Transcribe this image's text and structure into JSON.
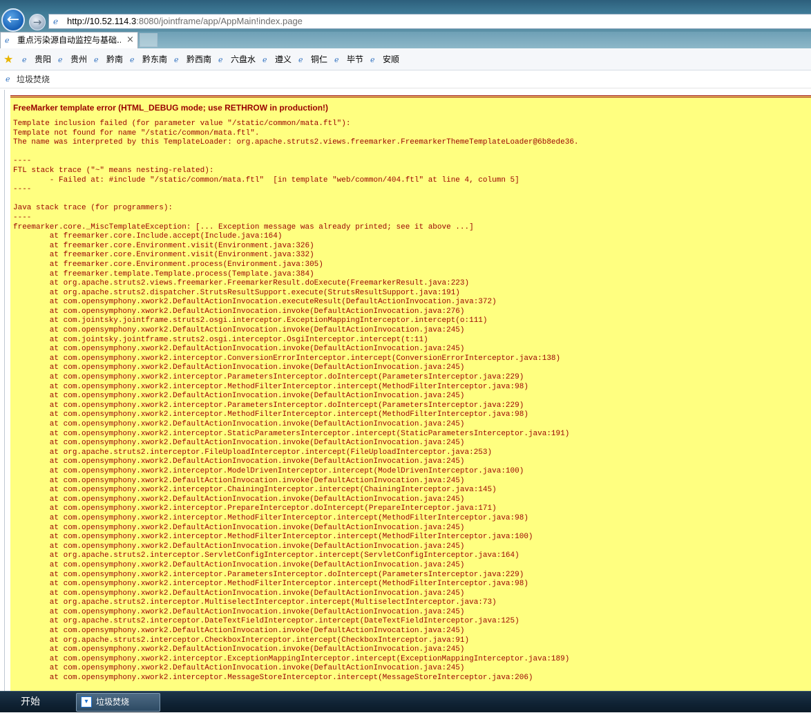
{
  "browser": {
    "back_icon": "←",
    "forward_icon": "→",
    "address_host": "http://10.52.114.3",
    "address_path": ":8080/jointframe/app/AppMain!index.page",
    "tab_title": "重点污染源自动监控与基础...",
    "tab_close": "×"
  },
  "favorites": {
    "items": [
      {
        "label": "贵阳"
      },
      {
        "label": "贵州"
      },
      {
        "label": "黔南"
      },
      {
        "label": "黔东南"
      },
      {
        "label": "黔西南"
      },
      {
        "label": "六盘水"
      },
      {
        "label": "遵义"
      },
      {
        "label": "铜仁"
      },
      {
        "label": "毕节"
      },
      {
        "label": "安顺"
      }
    ]
  },
  "page": {
    "header_title": "垃圾焚烧"
  },
  "error": {
    "title": "FreeMarker template error (HTML_DEBUG mode; use RETHROW in production!)",
    "message_lines": [
      "Template inclusion failed (for parameter value \"/static/common/mata.ftl\"):",
      "Template not found for name \"/static/common/mata.ftl\".",
      "The name was interpreted by this TemplateLoader: org.apache.struts2.views.freemarker.FreemarkerThemeTemplateLoader@6b8ede36.",
      "",
      "----",
      "FTL stack trace (\"~\" means nesting-related):",
      "        - Failed at: #include \"/static/common/mata.ftl\"  [in template \"web/common/404.ftl\" at line 4, column 5]",
      "----",
      "",
      "Java stack trace (for programmers):",
      "----",
      "freemarker.core._MiscTemplateException: [... Exception message was already printed; see it above ...]",
      "        at freemarker.core.Include.accept(Include.java:164)",
      "        at freemarker.core.Environment.visit(Environment.java:326)",
      "        at freemarker.core.Environment.visit(Environment.java:332)",
      "        at freemarker.core.Environment.process(Environment.java:305)",
      "        at freemarker.template.Template.process(Template.java:384)",
      "        at org.apache.struts2.views.freemarker.FreemarkerResult.doExecute(FreemarkerResult.java:223)",
      "        at org.apache.struts2.dispatcher.StrutsResultSupport.execute(StrutsResultSupport.java:191)",
      "        at com.opensymphony.xwork2.DefaultActionInvocation.executeResult(DefaultActionInvocation.java:372)",
      "        at com.opensymphony.xwork2.DefaultActionInvocation.invoke(DefaultActionInvocation.java:276)",
      "        at com.jointsky.jointframe.struts2.osgi.interceptor.ExceptionMappingInterceptor.intercept(o:111)",
      "        at com.opensymphony.xwork2.DefaultActionInvocation.invoke(DefaultActionInvocation.java:245)",
      "        at com.jointsky.jointframe.struts2.osgi.interceptor.OsgiInterceptor.intercept(t:11)",
      "        at com.opensymphony.xwork2.DefaultActionInvocation.invoke(DefaultActionInvocation.java:245)",
      "        at com.opensymphony.xwork2.interceptor.ConversionErrorInterceptor.intercept(ConversionErrorInterceptor.java:138)",
      "        at com.opensymphony.xwork2.DefaultActionInvocation.invoke(DefaultActionInvocation.java:245)",
      "        at com.opensymphony.xwork2.interceptor.ParametersInterceptor.doIntercept(ParametersInterceptor.java:229)",
      "        at com.opensymphony.xwork2.interceptor.MethodFilterInterceptor.intercept(MethodFilterInterceptor.java:98)",
      "        at com.opensymphony.xwork2.DefaultActionInvocation.invoke(DefaultActionInvocation.java:245)",
      "        at com.opensymphony.xwork2.interceptor.ParametersInterceptor.doIntercept(ParametersInterceptor.java:229)",
      "        at com.opensymphony.xwork2.interceptor.MethodFilterInterceptor.intercept(MethodFilterInterceptor.java:98)",
      "        at com.opensymphony.xwork2.DefaultActionInvocation.invoke(DefaultActionInvocation.java:245)",
      "        at com.opensymphony.xwork2.interceptor.StaticParametersInterceptor.intercept(StaticParametersInterceptor.java:191)",
      "        at com.opensymphony.xwork2.DefaultActionInvocation.invoke(DefaultActionInvocation.java:245)",
      "        at org.apache.struts2.interceptor.FileUploadInterceptor.intercept(FileUploadInterceptor.java:253)",
      "        at com.opensymphony.xwork2.DefaultActionInvocation.invoke(DefaultActionInvocation.java:245)",
      "        at com.opensymphony.xwork2.interceptor.ModelDrivenInterceptor.intercept(ModelDrivenInterceptor.java:100)",
      "        at com.opensymphony.xwork2.DefaultActionInvocation.invoke(DefaultActionInvocation.java:245)",
      "        at com.opensymphony.xwork2.interceptor.ChainingInterceptor.intercept(ChainingInterceptor.java:145)",
      "        at com.opensymphony.xwork2.DefaultActionInvocation.invoke(DefaultActionInvocation.java:245)",
      "        at com.opensymphony.xwork2.interceptor.PrepareInterceptor.doIntercept(PrepareInterceptor.java:171)",
      "        at com.opensymphony.xwork2.interceptor.MethodFilterInterceptor.intercept(MethodFilterInterceptor.java:98)",
      "        at com.opensymphony.xwork2.DefaultActionInvocation.invoke(DefaultActionInvocation.java:245)",
      "        at com.opensymphony.xwork2.interceptor.MethodFilterInterceptor.intercept(MethodFilterInterceptor.java:100)",
      "        at com.opensymphony.xwork2.DefaultActionInvocation.invoke(DefaultActionInvocation.java:245)",
      "        at org.apache.struts2.interceptor.ServletConfigInterceptor.intercept(ServletConfigInterceptor.java:164)",
      "        at com.opensymphony.xwork2.DefaultActionInvocation.invoke(DefaultActionInvocation.java:245)",
      "        at com.opensymphony.xwork2.interceptor.ParametersInterceptor.doIntercept(ParametersInterceptor.java:229)",
      "        at com.opensymphony.xwork2.interceptor.MethodFilterInterceptor.intercept(MethodFilterInterceptor.java:98)",
      "        at com.opensymphony.xwork2.DefaultActionInvocation.invoke(DefaultActionInvocation.java:245)",
      "        at org.apache.struts2.interceptor.MultiselectInterceptor.intercept(MultiselectInterceptor.java:73)",
      "        at com.opensymphony.xwork2.DefaultActionInvocation.invoke(DefaultActionInvocation.java:245)",
      "        at org.apache.struts2.interceptor.DateTextFieldInterceptor.intercept(DateTextFieldInterceptor.java:125)",
      "        at com.opensymphony.xwork2.DefaultActionInvocation.invoke(DefaultActionInvocation.java:245)",
      "        at org.apache.struts2.interceptor.CheckboxInterceptor.intercept(CheckboxInterceptor.java:91)",
      "        at com.opensymphony.xwork2.DefaultActionInvocation.invoke(DefaultActionInvocation.java:245)",
      "        at com.opensymphony.xwork2.interceptor.ExceptionMappingInterceptor.intercept(ExceptionMappingInterceptor.java:189)",
      "        at com.opensymphony.xwork2.DefaultActionInvocation.invoke(DefaultActionInvocation.java:245)",
      "        at com.opensymphony.xwork2.interceptor.MessageStoreInterceptor.intercept(MessageStoreInterceptor.java:206)"
    ]
  },
  "taskbar": {
    "start_label": "开始",
    "task_label": "垃圾焚烧"
  },
  "colors": {
    "error_background": "#ffff80",
    "error_text": "#990000"
  },
  "icons": {
    "favorites": "favorites-star-icon",
    "ie": "ie-logo-icon",
    "back": "back-arrow-icon",
    "forward": "forward-arrow-icon"
  }
}
